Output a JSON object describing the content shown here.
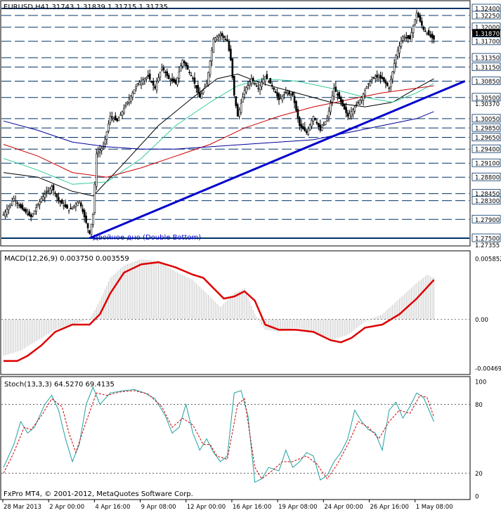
{
  "header": {
    "symbol": "EURUSD,H4",
    "ohlc": "1.31743 1.31839 1.31715 1.31735"
  },
  "annotation": "Двойное дно (Double Bottom)",
  "copyright": "FxPro MT4, © 2001-2012, MetaQuotes Software Corp.",
  "colors": {
    "candles": "#000000",
    "levels": "#003366",
    "trendline": "#0000cc",
    "ma_fast": "#000000",
    "ma_green": "#33cc99",
    "ma_red": "#cc0000",
    "ma_blue": "#000099",
    "macd_line": "#dd0000",
    "macd_hist": "#c8c8c8",
    "stoch_main": "#20a0a0",
    "stoch_signal": "#cc0000"
  },
  "chart_data": [
    {
      "type": "candlestick",
      "panel": "price",
      "symbol": "EURUSD",
      "timeframe": "H4",
      "ylim": [
        1.2735,
        1.3255
      ],
      "price_labels": [
        "1.32400",
        "1.32250",
        "1.32000",
        "1.31870",
        "1.31700",
        "1.31350",
        "1.31150",
        "1.30850",
        "1.30500",
        "1.30370",
        "1.30050",
        "1.29850",
        "1.29650",
        "1.29400",
        "1.29100",
        "1.28800",
        "1.28450",
        "1.28300",
        "1.27900",
        "1.27500",
        "1.27355"
      ],
      "levels": [
        1.324,
        1.3225,
        1.32,
        1.317,
        1.3135,
        1.3115,
        1.3085,
        1.305,
        1.3005,
        1.2985,
        1.2965,
        1.294,
        1.291,
        1.288,
        1.2845,
        1.283,
        1.279,
        1.275
      ],
      "current_price": "1.31870",
      "x_labels": [
        "28 Mar 2013",
        "2 Apr 00:00",
        "4 Apr 16:00",
        "9 Apr 08:00",
        "12 Apr 00:00",
        "16 Apr 16:00",
        "19 Apr 08:00",
        "24 Apr 00:00",
        "26 Apr 16:00",
        "1 May 08:00"
      ],
      "close_path": [
        [
          0,
          1.28
        ],
        [
          6,
          1.2835
        ],
        [
          10,
          1.2815
        ],
        [
          16,
          1.2795
        ],
        [
          22,
          1.2835
        ],
        [
          28,
          1.286
        ],
        [
          32,
          1.283
        ],
        [
          38,
          1.281
        ],
        [
          44,
          1.283
        ],
        [
          50,
          1.276
        ],
        [
          52,
          1.28
        ],
        [
          54,
          1.293
        ],
        [
          58,
          1.2945
        ],
        [
          62,
          1.301
        ],
        [
          66,
          1.3
        ],
        [
          72,
          1.304
        ],
        [
          78,
          1.308
        ],
        [
          84,
          1.3095
        ],
        [
          88,
          1.307
        ],
        [
          92,
          1.3115
        ],
        [
          96,
          1.309
        ],
        [
          100,
          1.308
        ],
        [
          104,
          1.313
        ],
        [
          110,
          1.309
        ],
        [
          114,
          1.305
        ],
        [
          118,
          1.308
        ],
        [
          122,
          1.3175
        ],
        [
          126,
          1.3185
        ],
        [
          130,
          1.317
        ],
        [
          132,
          1.313
        ],
        [
          134,
          1.3055
        ],
        [
          136,
          1.301
        ],
        [
          140,
          1.3065
        ],
        [
          144,
          1.309
        ],
        [
          148,
          1.307
        ],
        [
          152,
          1.3095
        ],
        [
          156,
          1.3075
        ],
        [
          160,
          1.3045
        ],
        [
          164,
          1.306
        ],
        [
          168,
          1.3055
        ],
        [
          172,
          1.299
        ],
        [
          176,
          1.2975
        ],
        [
          180,
          1.301
        ],
        [
          184,
          1.298
        ],
        [
          188,
          1.3005
        ],
        [
          192,
          1.307
        ],
        [
          196,
          1.304
        ],
        [
          200,
          1.301
        ],
        [
          204,
          1.303
        ],
        [
          208,
          1.305
        ],
        [
          212,
          1.308
        ],
        [
          216,
          1.3095
        ],
        [
          220,
          1.309
        ],
        [
          224,
          1.307
        ],
        [
          228,
          1.314
        ],
        [
          232,
          1.318
        ],
        [
          236,
          1.3175
        ],
        [
          240,
          1.323
        ],
        [
          244,
          1.3195
        ],
        [
          248,
          1.318
        ],
        [
          250,
          1.3174
        ]
      ],
      "trendline": {
        "from": [
          50,
          1.275
        ],
        "to": [
          268,
          1.3085
        ]
      },
      "moving_averages": [
        {
          "color": "#000000",
          "points": [
            [
              0,
              1.289
            ],
            [
              20,
              1.288
            ],
            [
              40,
              1.285
            ],
            [
              52,
              1.284
            ],
            [
              70,
              1.291
            ],
            [
              90,
              1.299
            ],
            [
              110,
              1.305
            ],
            [
              124,
              1.309
            ],
            [
              136,
              1.31
            ],
            [
              150,
              1.308
            ],
            [
              170,
              1.306
            ],
            [
              190,
              1.304
            ],
            [
              210,
              1.303
            ],
            [
              226,
              1.304
            ],
            [
              240,
              1.307
            ],
            [
              250,
              1.309
            ]
          ]
        },
        {
          "color": "#33cc99",
          "points": [
            [
              0,
              1.292
            ],
            [
              20,
              1.2895
            ],
            [
              40,
              1.2865
            ],
            [
              60,
              1.287
            ],
            [
              80,
              1.292
            ],
            [
              100,
              1.299
            ],
            [
              120,
              1.304
            ],
            [
              136,
              1.3075
            ],
            [
              150,
              1.309
            ],
            [
              170,
              1.3085
            ],
            [
              190,
              1.307
            ],
            [
              210,
              1.305
            ],
            [
              226,
              1.304
            ],
            [
              240,
              1.306
            ],
            [
              250,
              1.308
            ]
          ]
        },
        {
          "color": "#cc0000",
          "points": [
            [
              0,
              1.295
            ],
            [
              20,
              1.2925
            ],
            [
              40,
              1.289
            ],
            [
              60,
              1.288
            ],
            [
              80,
              1.29
            ],
            [
              100,
              1.2925
            ],
            [
              120,
              1.295
            ],
            [
              140,
              1.2985
            ],
            [
              160,
              1.301
            ],
            [
              180,
              1.303
            ],
            [
              200,
              1.3045
            ],
            [
              220,
              1.306
            ],
            [
              240,
              1.307
            ],
            [
              250,
              1.3075
            ]
          ]
        },
        {
          "color": "#000099",
          "points": [
            [
              0,
              1.3
            ],
            [
              20,
              1.298
            ],
            [
              40,
              1.2955
            ],
            [
              60,
              1.2945
            ],
            [
              80,
              1.294
            ],
            [
              100,
              1.294
            ],
            [
              120,
              1.2945
            ],
            [
              140,
              1.295
            ],
            [
              160,
              1.2955
            ],
            [
              180,
              1.296
            ],
            [
              200,
              1.2975
            ],
            [
              220,
              1.299
            ],
            [
              240,
              1.3005
            ],
            [
              250,
              1.302
            ]
          ]
        }
      ]
    },
    {
      "type": "macd",
      "panel": "macd",
      "title": "MACD(12,26,9) 0.003750 0.003559",
      "params": [
        12,
        26,
        9
      ],
      "main": 0.00375,
      "signal": 0.003559,
      "ylim": [
        -0.00469,
        0.005852
      ],
      "tick_labels": [
        "0.005852",
        "0.00",
        "-0.00469"
      ],
      "signal_path": [
        [
          0,
          -0.004
        ],
        [
          8,
          -0.004
        ],
        [
          14,
          -0.0035
        ],
        [
          22,
          -0.0025
        ],
        [
          30,
          -0.0012
        ],
        [
          40,
          -0.0005
        ],
        [
          50,
          -0.0005
        ],
        [
          56,
          0.0005
        ],
        [
          62,
          0.0025
        ],
        [
          70,
          0.0045
        ],
        [
          80,
          0.0053
        ],
        [
          90,
          0.0055
        ],
        [
          100,
          0.005
        ],
        [
          110,
          0.0043
        ],
        [
          116,
          0.004
        ],
        [
          122,
          0.003
        ],
        [
          128,
          0.002
        ],
        [
          134,
          0.0022
        ],
        [
          140,
          0.0027
        ],
        [
          146,
          0.0018
        ],
        [
          152,
          -0.0005
        ],
        [
          160,
          -0.001
        ],
        [
          170,
          -0.001
        ],
        [
          180,
          -0.0012
        ],
        [
          190,
          -0.002
        ],
        [
          196,
          -0.0022
        ],
        [
          202,
          -0.0018
        ],
        [
          210,
          -0.0008
        ],
        [
          220,
          -0.0005
        ],
        [
          230,
          0.0005
        ],
        [
          240,
          0.002
        ],
        [
          250,
          0.0038
        ]
      ],
      "histogram": [
        [
          0,
          -0.0035
        ],
        [
          10,
          -0.003
        ],
        [
          20,
          -0.002
        ],
        [
          30,
          -0.001
        ],
        [
          40,
          -0.0005
        ],
        [
          50,
          0.0
        ],
        [
          56,
          0.0018
        ],
        [
          62,
          0.004
        ],
        [
          70,
          0.0052
        ],
        [
          80,
          0.0058
        ],
        [
          90,
          0.0056
        ],
        [
          100,
          0.0046
        ],
        [
          110,
          0.0038
        ],
        [
          118,
          0.0025
        ],
        [
          126,
          0.0012
        ],
        [
          134,
          0.0025
        ],
        [
          140,
          0.003
        ],
        [
          146,
          0.0005
        ],
        [
          152,
          -0.001
        ],
        [
          160,
          -0.0012
        ],
        [
          170,
          -0.0008
        ],
        [
          180,
          -0.0012
        ],
        [
          190,
          -0.002
        ],
        [
          200,
          -0.0015
        ],
        [
          210,
          -0.0002
        ],
        [
          220,
          0.0005
        ],
        [
          230,
          0.002
        ],
        [
          240,
          0.0035
        ],
        [
          246,
          0.0043
        ],
        [
          250,
          0.004
        ]
      ]
    },
    {
      "type": "stochastic",
      "panel": "stoch",
      "title": "Stoch(13,3,3) 64.5270 69.4135",
      "params": [
        13,
        3,
        3
      ],
      "k": 64.527,
      "d": 69.4135,
      "ylim": [
        0,
        100
      ],
      "tick_labels": [
        "100",
        "80",
        "20",
        "0"
      ],
      "levels": [
        80,
        20
      ],
      "k_path": [
        [
          0,
          25
        ],
        [
          6,
          45
        ],
        [
          10,
          65
        ],
        [
          14,
          55
        ],
        [
          18,
          60
        ],
        [
          24,
          80
        ],
        [
          28,
          88
        ],
        [
          32,
          75
        ],
        [
          36,
          50
        ],
        [
          40,
          30
        ],
        [
          44,
          45
        ],
        [
          48,
          80
        ],
        [
          52,
          95
        ],
        [
          56,
          80
        ],
        [
          62,
          90
        ],
        [
          70,
          92
        ],
        [
          76,
          93
        ],
        [
          82,
          90
        ],
        [
          88,
          85
        ],
        [
          94,
          70
        ],
        [
          98,
          55
        ],
        [
          102,
          60
        ],
        [
          106,
          80
        ],
        [
          110,
          55
        ],
        [
          114,
          40
        ],
        [
          118,
          50
        ],
        [
          122,
          38
        ],
        [
          126,
          30
        ],
        [
          130,
          35
        ],
        [
          134,
          90
        ],
        [
          138,
          92
        ],
        [
          142,
          70
        ],
        [
          146,
          12
        ],
        [
          150,
          15
        ],
        [
          154,
          25
        ],
        [
          160,
          22
        ],
        [
          164,
          40
        ],
        [
          168,
          25
        ],
        [
          172,
          30
        ],
        [
          176,
          38
        ],
        [
          180,
          35
        ],
        [
          184,
          14
        ],
        [
          188,
          18
        ],
        [
          192,
          30
        ],
        [
          196,
          38
        ],
        [
          200,
          50
        ],
        [
          204,
          75
        ],
        [
          208,
          65
        ],
        [
          212,
          58
        ],
        [
          216,
          55
        ],
        [
          220,
          40
        ],
        [
          224,
          75
        ],
        [
          228,
          82
        ],
        [
          232,
          68
        ],
        [
          236,
          78
        ],
        [
          240,
          90
        ],
        [
          244,
          86
        ],
        [
          250,
          65
        ]
      ],
      "d_path": [
        [
          0,
          20
        ],
        [
          6,
          38
        ],
        [
          12,
          60
        ],
        [
          16,
          58
        ],
        [
          22,
          70
        ],
        [
          28,
          85
        ],
        [
          34,
          78
        ],
        [
          38,
          55
        ],
        [
          42,
          38
        ],
        [
          48,
          65
        ],
        [
          54,
          90
        ],
        [
          60,
          88
        ],
        [
          68,
          91
        ],
        [
          76,
          92
        ],
        [
          84,
          89
        ],
        [
          92,
          78
        ],
        [
          98,
          60
        ],
        [
          104,
          68
        ],
        [
          110,
          62
        ],
        [
          116,
          45
        ],
        [
          120,
          45
        ],
        [
          124,
          35
        ],
        [
          130,
          32
        ],
        [
          136,
          80
        ],
        [
          140,
          85
        ],
        [
          146,
          25
        ],
        [
          150,
          15
        ],
        [
          156,
          22
        ],
        [
          162,
          30
        ],
        [
          168,
          30
        ],
        [
          176,
          35
        ],
        [
          182,
          28
        ],
        [
          188,
          15
        ],
        [
          194,
          28
        ],
        [
          200,
          45
        ],
        [
          206,
          65
        ],
        [
          212,
          60
        ],
        [
          218,
          50
        ],
        [
          224,
          65
        ],
        [
          230,
          75
        ],
        [
          236,
          72
        ],
        [
          242,
          88
        ],
        [
          246,
          86
        ],
        [
          250,
          69
        ]
      ]
    }
  ]
}
